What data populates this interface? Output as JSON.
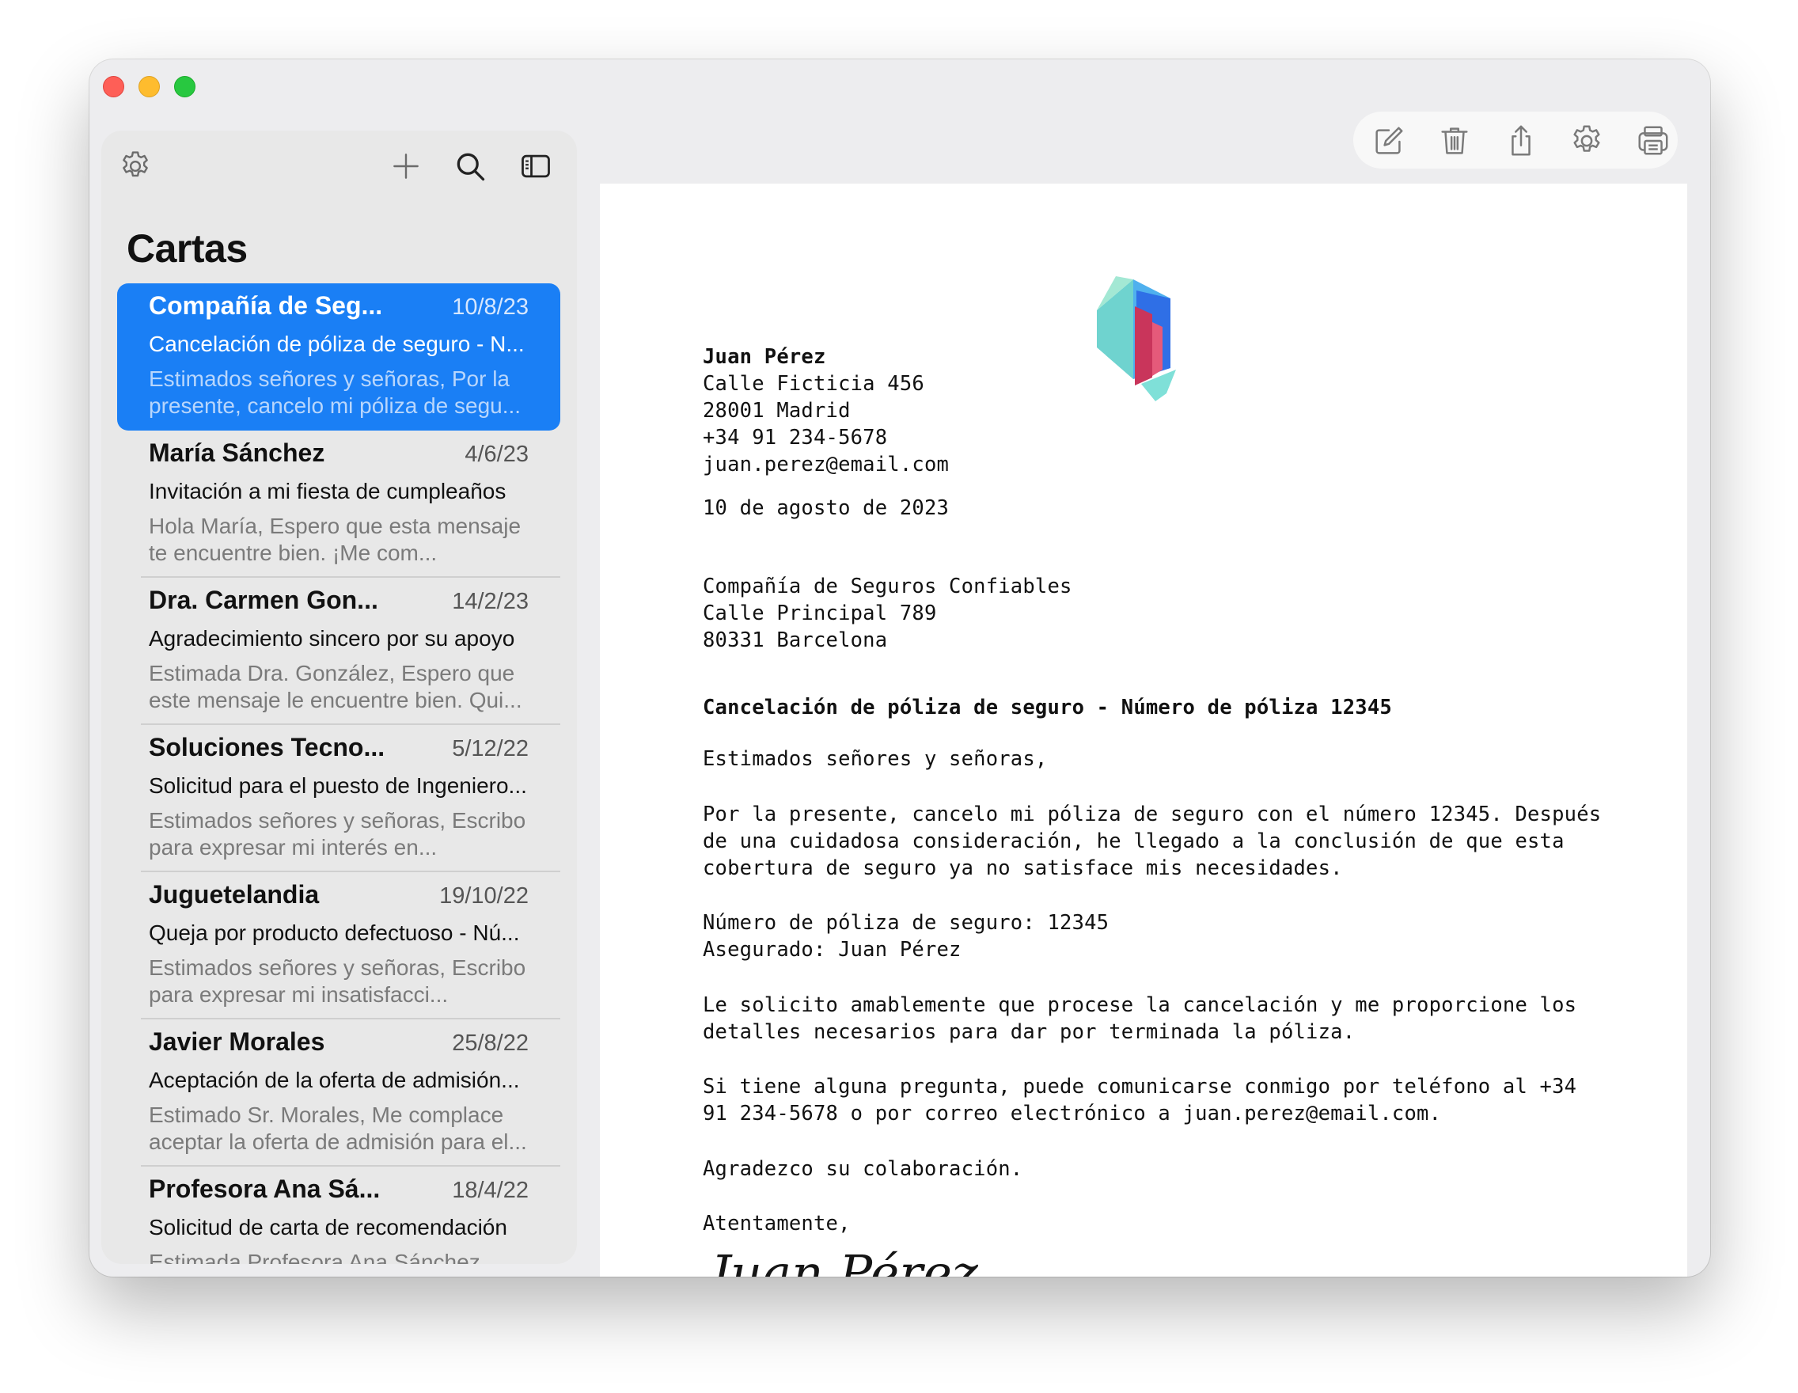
{
  "sidebar": {
    "title": "Cartas",
    "items": [
      {
        "from": "Compañía de Seg...",
        "date": "10/8/23",
        "subject": "Cancelación de póliza de seguro - N...",
        "preview": "Estimados señores y señoras,  Por la presente, cancelo mi póliza de segu...",
        "selected": true
      },
      {
        "from": "María Sánchez",
        "date": "4/6/23",
        "subject": "Invitación a mi fiesta de cumpleaños",
        "preview": "Hola María,  Espero que esta mensaje te encuentre bien. ¡Me com..."
      },
      {
        "from": "Dra. Carmen Gon...",
        "date": "14/2/23",
        "subject": "Agradecimiento sincero por su apoyo",
        "preview": "Estimada Dra. González,  Espero que este mensaje le encuentre bien. Qui..."
      },
      {
        "from": "Soluciones Tecno...",
        "date": "5/12/22",
        "subject": "Solicitud para el puesto de Ingeniero...",
        "preview": "Estimados señores y señoras,  Escribo para expresar mi interés en..."
      },
      {
        "from": "Juguetelandia",
        "date": "19/10/22",
        "subject": "Queja por producto defectuoso - Nú...",
        "preview": "Estimados señores y señoras,  Escribo para expresar mi insatisfacci..."
      },
      {
        "from": "Javier Morales",
        "date": "25/8/22",
        "subject": "Aceptación de la oferta de admisión...",
        "preview": "Estimado Sr. Morales,  Me complace aceptar la oferta de admisión para el..."
      },
      {
        "from": "Profesora Ana Sá...",
        "date": "18/4/22",
        "subject": "Solicitud de carta de recomendación",
        "preview": "Estimada Profesora Ana Sánchez"
      }
    ]
  },
  "letter": {
    "sender_name": "Juan Pérez",
    "sender_address": "Calle Ficticia 456\n28001 Madrid\n+34 91 234-5678\njuan.perez@email.com",
    "date": "10 de agosto de 2023",
    "recipient": "Compañía de Seguros Confiables\nCalle Principal 789\n80331 Barcelona",
    "subject": "Cancelación de póliza de seguro - Número de póliza 12345",
    "salutation": "Estimados señores y señoras,",
    "paragraph1": "Por la presente, cancelo mi póliza de seguro con el número 12345. Después\nde una cuidadosa consideración, he llegado a la conclusión de que esta\ncobertura de seguro ya no satisface mis necesidades.",
    "policy_info": "Número de póliza de seguro: 12345\nAsegurado: Juan Pérez",
    "paragraph2": "Le solicito amablemente que procese la cancelación y me proporcione los\ndetalles necesarios para dar por terminada la póliza.",
    "paragraph3": "Si tiene alguna pregunta, puede comunicarse conmigo por teléfono al +34\n91 234-5678 o por correo electrónico a juan.perez@email.com.",
    "thanks": "Agradezco su colaboración.",
    "closing": "Atentamente,",
    "signature": "Juan Pérez"
  },
  "icons": {
    "sidebar": [
      "gear-icon",
      "plus-icon",
      "search-icon",
      "sidebar-toggle-icon"
    ],
    "toolbar": [
      "compose-icon",
      "trash-icon",
      "share-icon",
      "gear-icon",
      "print-icon"
    ]
  },
  "colors": {
    "accent": "#1a7ff5",
    "close": "#fe5f57",
    "minimize": "#febc2e",
    "zoom": "#28c840"
  }
}
